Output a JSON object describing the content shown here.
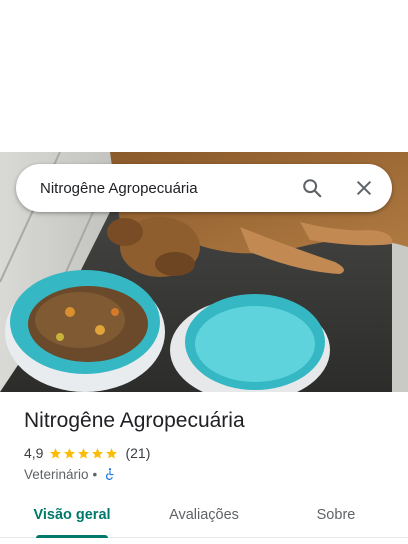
{
  "search": {
    "query": "Nitrogêne Agropecuária",
    "search_icon": "search-icon",
    "close_icon": "close-icon"
  },
  "photo": {
    "subject": "puppy-with-food-and-water-bowls"
  },
  "place": {
    "name": "Nitrogêne Agropecuária",
    "rating": "4,9",
    "rating_stars": 5,
    "review_count": "(21)",
    "category": "Veterinário",
    "separator": "•",
    "accessibility_icon": "wheelchair-icon"
  },
  "tabs": [
    {
      "label": "Visão geral",
      "active": true
    },
    {
      "label": "Avaliações",
      "active": false
    },
    {
      "label": "Sobre",
      "active": false
    }
  ],
  "colors": {
    "accent": "#00796b",
    "star": "#fbbc04",
    "accessibility": "#1a73e8",
    "bowl": "#35b8c4"
  }
}
